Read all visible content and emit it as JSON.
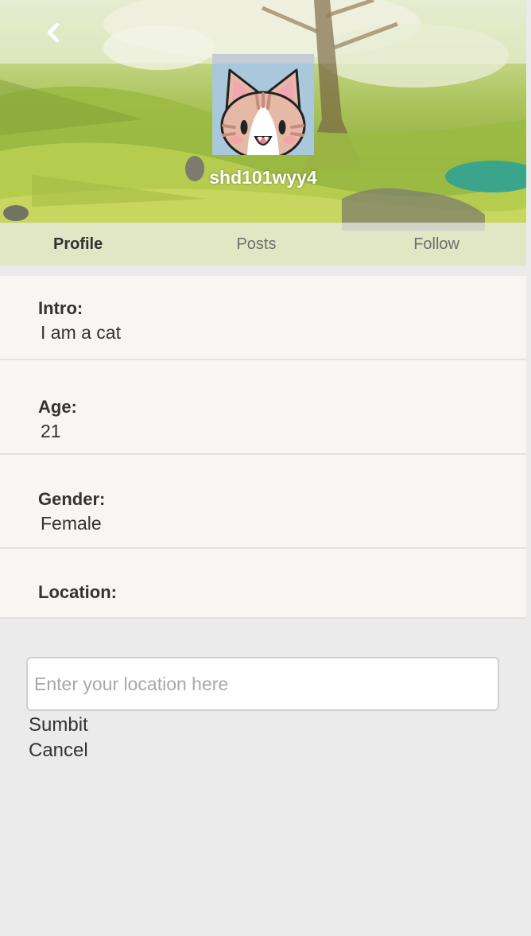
{
  "header": {
    "back_icon": "chevron-left-icon",
    "username": "shd101wyy4",
    "avatar": "cat-avatar"
  },
  "tabs": [
    {
      "label": "Profile",
      "active": true
    },
    {
      "label": "Posts",
      "active": false
    },
    {
      "label": "Follow",
      "active": false
    }
  ],
  "profile": {
    "intro": {
      "label": "Intro:",
      "value": "I am a cat"
    },
    "age": {
      "label": "Age:",
      "value": "21"
    },
    "gender": {
      "label": "Gender:",
      "value": "Female"
    },
    "location": {
      "label": "Location:",
      "value": ""
    }
  },
  "location_editor": {
    "placeholder": "Enter your location here",
    "value": "",
    "submit_label": "Sumbit",
    "cancel_label": "Cancel"
  }
}
